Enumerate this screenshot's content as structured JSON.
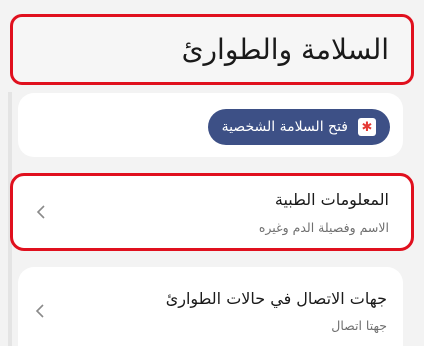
{
  "header": {
    "title": "السلامة والطوارئ"
  },
  "emergency_sharing": {
    "button_label": "فتح السلامة الشخصية",
    "icon": "personal-safety-icon",
    "button_color": "#3d5086"
  },
  "medical_info": {
    "title": "المعلومات الطبية",
    "subtitle": "الاسم وفصيلة الدم وغيره",
    "chevron": "<"
  },
  "emergency_contacts": {
    "title": "جهات الاتصال في حالات الطوارئ",
    "subtitle": "جهتا اتصال",
    "chevron": "<"
  },
  "colors": {
    "highlight": "#e0101e",
    "background": "#f3f3f3"
  }
}
